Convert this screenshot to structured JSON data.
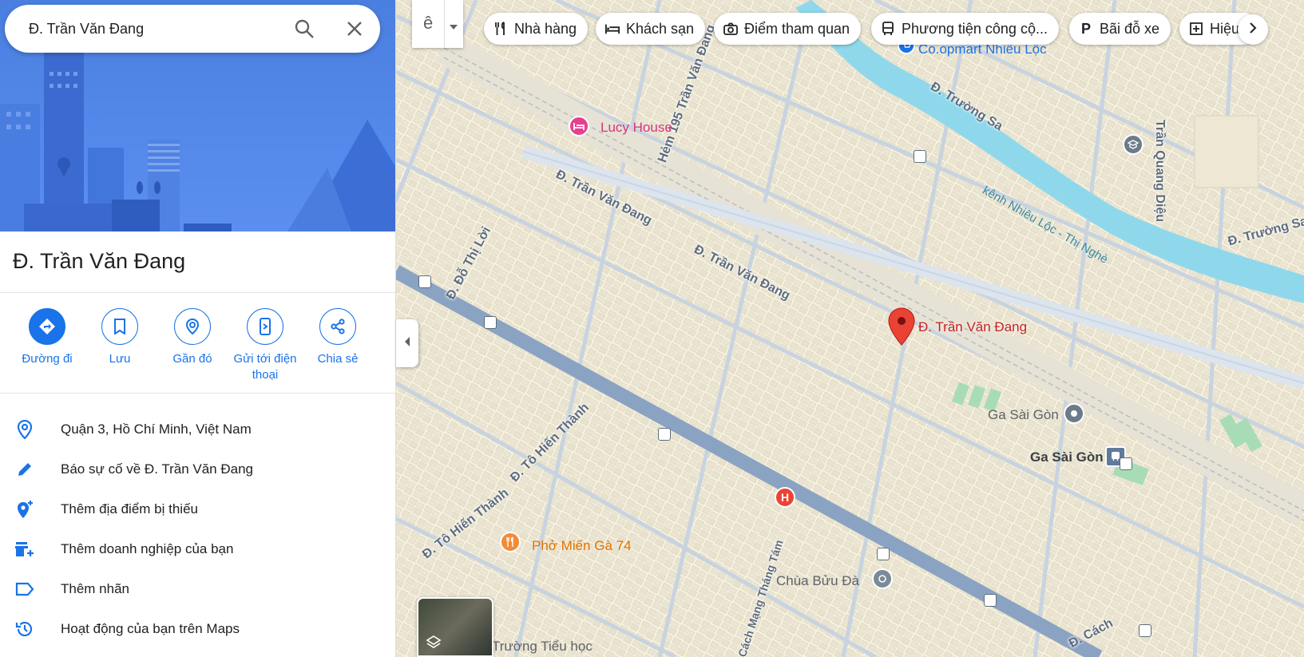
{
  "search": {
    "value": "Đ. Trần Văn Đang"
  },
  "place": {
    "title": "Đ. Trần Văn Đang"
  },
  "actions": [
    {
      "label": "Đường đi"
    },
    {
      "label": "Lưu"
    },
    {
      "label": "Gần đó"
    },
    {
      "label": "Gửi tới điện\nthoại"
    },
    {
      "label": "Chia sẻ"
    }
  ],
  "info_rows": [
    {
      "text": "Quận 3, Hồ Chí Minh, Việt Nam",
      "icon": "location-pin-icon"
    },
    {
      "text": "Báo sự cố về Đ. Trần Văn Đang",
      "icon": "pencil-icon"
    },
    {
      "text": "Thêm địa điểm bị thiếu",
      "icon": "add-location-icon"
    },
    {
      "text": "Thêm doanh nghiệp của bạn",
      "icon": "add-business-icon"
    },
    {
      "text": "Thêm nhãn",
      "icon": "label-icon"
    },
    {
      "text": "Hoạt động của bạn trên Maps",
      "icon": "history-icon"
    }
  ],
  "chips": [
    {
      "label": "Nhà hàng",
      "icon": "fork-knife-icon"
    },
    {
      "label": "Khách sạn",
      "icon": "bed-icon"
    },
    {
      "label": "Điểm tham quan",
      "icon": "camera-icon"
    },
    {
      "label": "Phương tiện công cộ...",
      "icon": "bus-icon"
    },
    {
      "label": "Bãi đỗ xe",
      "icon": "parking-icon"
    },
    {
      "label": "Hiệu",
      "icon": "pharmacy-icon"
    }
  ],
  "lang_button": {
    "label": "ê"
  },
  "map_labels": {
    "coopmart": "Co.opmart Nhiêu Lộc",
    "lucy_house": "Lucy House",
    "hem195": "Hẻm 195 Trần Văn Đang",
    "truong_sa_1": "Đ. Trường Sa",
    "truong_sa_2": "Đ. Trường Sa",
    "kenh": "kênh Nhiêu Lộc - Thị Nghè",
    "tran_quang_dieu": "Trần Quang Diệu",
    "tvd_1": "Đ. Trần Văn Đang",
    "tvd_2": "Đ. Trần Văn Đang",
    "do_thi_loi": "Đ. Đỗ Thị Lời",
    "pin_label": "Đ. Trần Văn Đang",
    "ga_sai_gon_1": "Ga Sài Gòn",
    "ga_sai_gon_2": "Ga Sài Gòn",
    "to_hien_thanh_1": "Đ. Tô Hiến Thành",
    "to_hien_thanh_2": "Đ. Tô Hiến Thành",
    "pho_mien_ga": "Phở Miến Gà 74",
    "cach_mang_thang_tam": "Cách Mạng Tháng Tám",
    "chua_buu_da": "Chùa Bửu Đà",
    "truong_tieu_hoc": "Trường Tiểu học",
    "cach_bottom": "Đ. Cách"
  },
  "colors": {
    "accent": "#1a73e8",
    "pin": "#ea4335",
    "water": "#8fd8ec",
    "road_main": "#8aa3c2"
  }
}
